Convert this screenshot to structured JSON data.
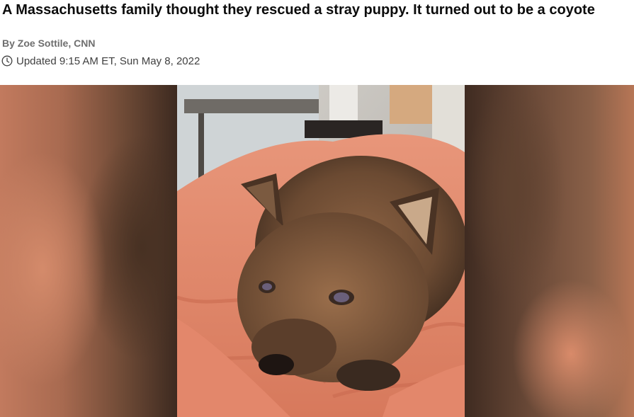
{
  "article": {
    "headline": "A Massachusetts family thought they rescued a stray puppy. It turned out to be a coyote",
    "byline": "By Zoe Sottile, CNN",
    "timestamp": "Updated 9:15 AM ET, Sun May 8, 2022",
    "timestamp_icon": "clock-icon"
  },
  "media": {
    "subject": "coyote pup on towel",
    "colors": {
      "towel": "#e08a6c",
      "fur": "#6b4a32",
      "background_blur_left": "#c27a5e",
      "background_blur_right": "#8a6048"
    }
  }
}
